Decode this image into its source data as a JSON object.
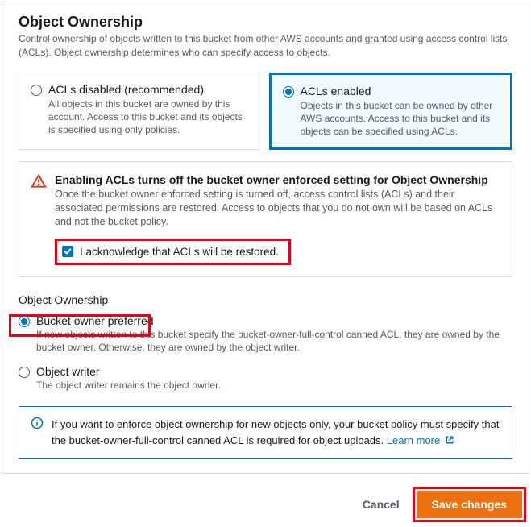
{
  "header": {
    "title": "Object Ownership",
    "description": "Control ownership of objects written to this bucket from other AWS accounts and granted using access control lists (ACLs). Object ownership determines who can specify access to objects."
  },
  "acl_options": {
    "disabled": {
      "label": "ACLs disabled (recommended)",
      "description": "All objects in this bucket are owned by this account. Access to this bucket and its objects is specified using only policies."
    },
    "enabled": {
      "label": "ACLs enabled",
      "description": "Objects in this bucket can be owned by other AWS accounts. Access to this bucket and its objects can be specified using ACLs."
    }
  },
  "warning": {
    "title": "Enabling ACLs turns off the bucket owner enforced setting for Object Ownership",
    "text": "Once the bucket owner enforced setting is turned off, access control lists (ACLs) and their associated permissions are restored. Access to objects that you do not own will be based on ACLs and not the bucket policy.",
    "ack_label": "I acknowledge that ACLs will be restored."
  },
  "ownership": {
    "section_label": "Object Ownership",
    "bucket_owner": {
      "label": "Bucket owner preferred",
      "description": "If new objects written to this bucket specify the bucket-owner-full-control canned ACL, they are owned by the bucket owner. Otherwise, they are owned by the object writer."
    },
    "object_writer": {
      "label": "Object writer",
      "description": "The object writer remains the object owner."
    }
  },
  "info": {
    "text": "If you want to enforce object ownership for new objects only, your bucket policy must specify that the bucket-owner-full-control canned ACL is required for object uploads.",
    "link_label": "Learn more"
  },
  "footer": {
    "cancel": "Cancel",
    "save": "Save changes"
  }
}
